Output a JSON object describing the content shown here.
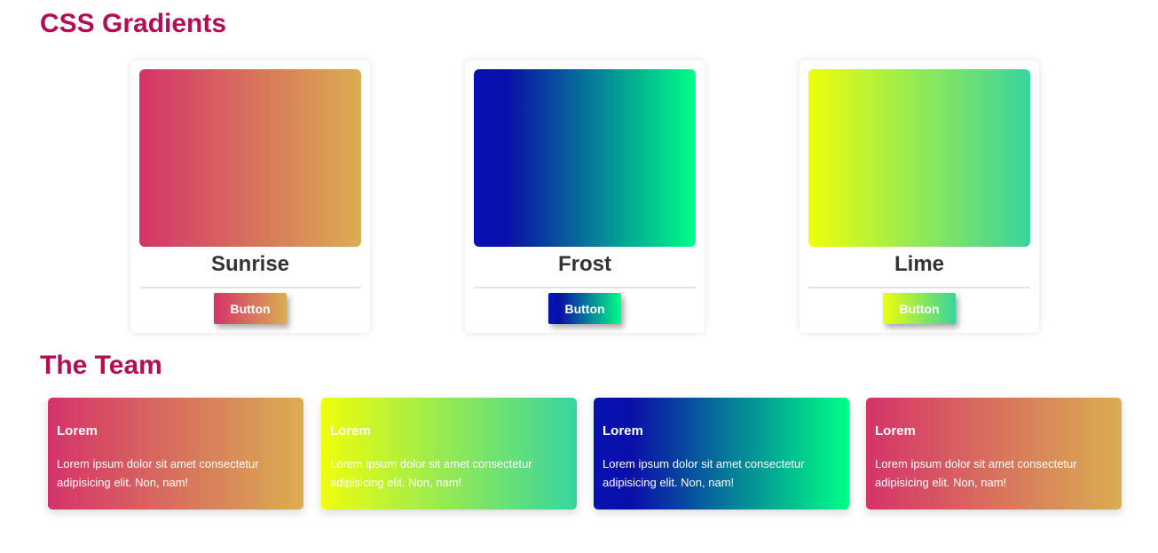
{
  "sections": {
    "gradients_title": "CSS Gradients",
    "team_title": "The Team"
  },
  "gradient_cards": [
    {
      "name": "Sunrise",
      "button": "Button",
      "colors": [
        "#d53369",
        "#daae51"
      ]
    },
    {
      "name": "Frost",
      "button": "Button",
      "colors": [
        "#0512b3",
        "#00ff87"
      ]
    },
    {
      "name": "Lime",
      "button": "Button",
      "colors": [
        "#eefe0b",
        "#37d4a0"
      ]
    }
  ],
  "team_cards": [
    {
      "name": "Lorem",
      "text": "Lorem ipsum dolor sit amet consectetur adipisicing elit. Non, nam!",
      "gradient": "Sunrise"
    },
    {
      "name": "Lorem",
      "text": "Lorem ipsum dolor sit amet consectetur adipisicing elit. Non, nam!",
      "gradient": "Lime"
    },
    {
      "name": "Lorem",
      "text": "Lorem ipsum dolor sit amet consectetur adipisicing elit. Non, nam!",
      "gradient": "Frost"
    },
    {
      "name": "Lorem",
      "text": "Lorem ipsum dolor sit amet consectetur adipisicing elit. Non, nam!",
      "gradient": "Sunrise"
    }
  ],
  "colors": {
    "title": "#b30e55",
    "card_name": "#333333"
  }
}
